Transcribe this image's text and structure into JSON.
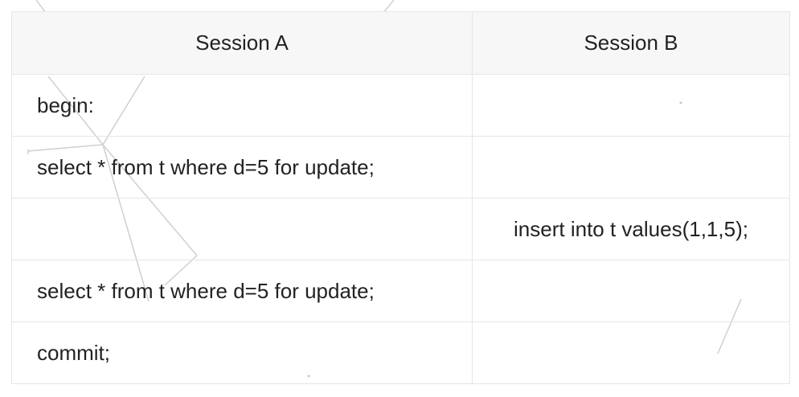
{
  "table": {
    "headers": [
      "Session A",
      "Session B"
    ],
    "rows": [
      {
        "session_a": "begin:",
        "session_b": ""
      },
      {
        "session_a": "select * from t where d=5 for update;",
        "session_b": ""
      },
      {
        "session_a": "",
        "session_b": "insert into t values(1,1,5);"
      },
      {
        "session_a": "select * from t where d=5 for update;",
        "session_b": ""
      },
      {
        "session_a": "commit;",
        "session_b": ""
      }
    ]
  },
  "colors": {
    "header_background": "#f7f7f7",
    "border": "#e6e6e6",
    "text": "#222222"
  }
}
